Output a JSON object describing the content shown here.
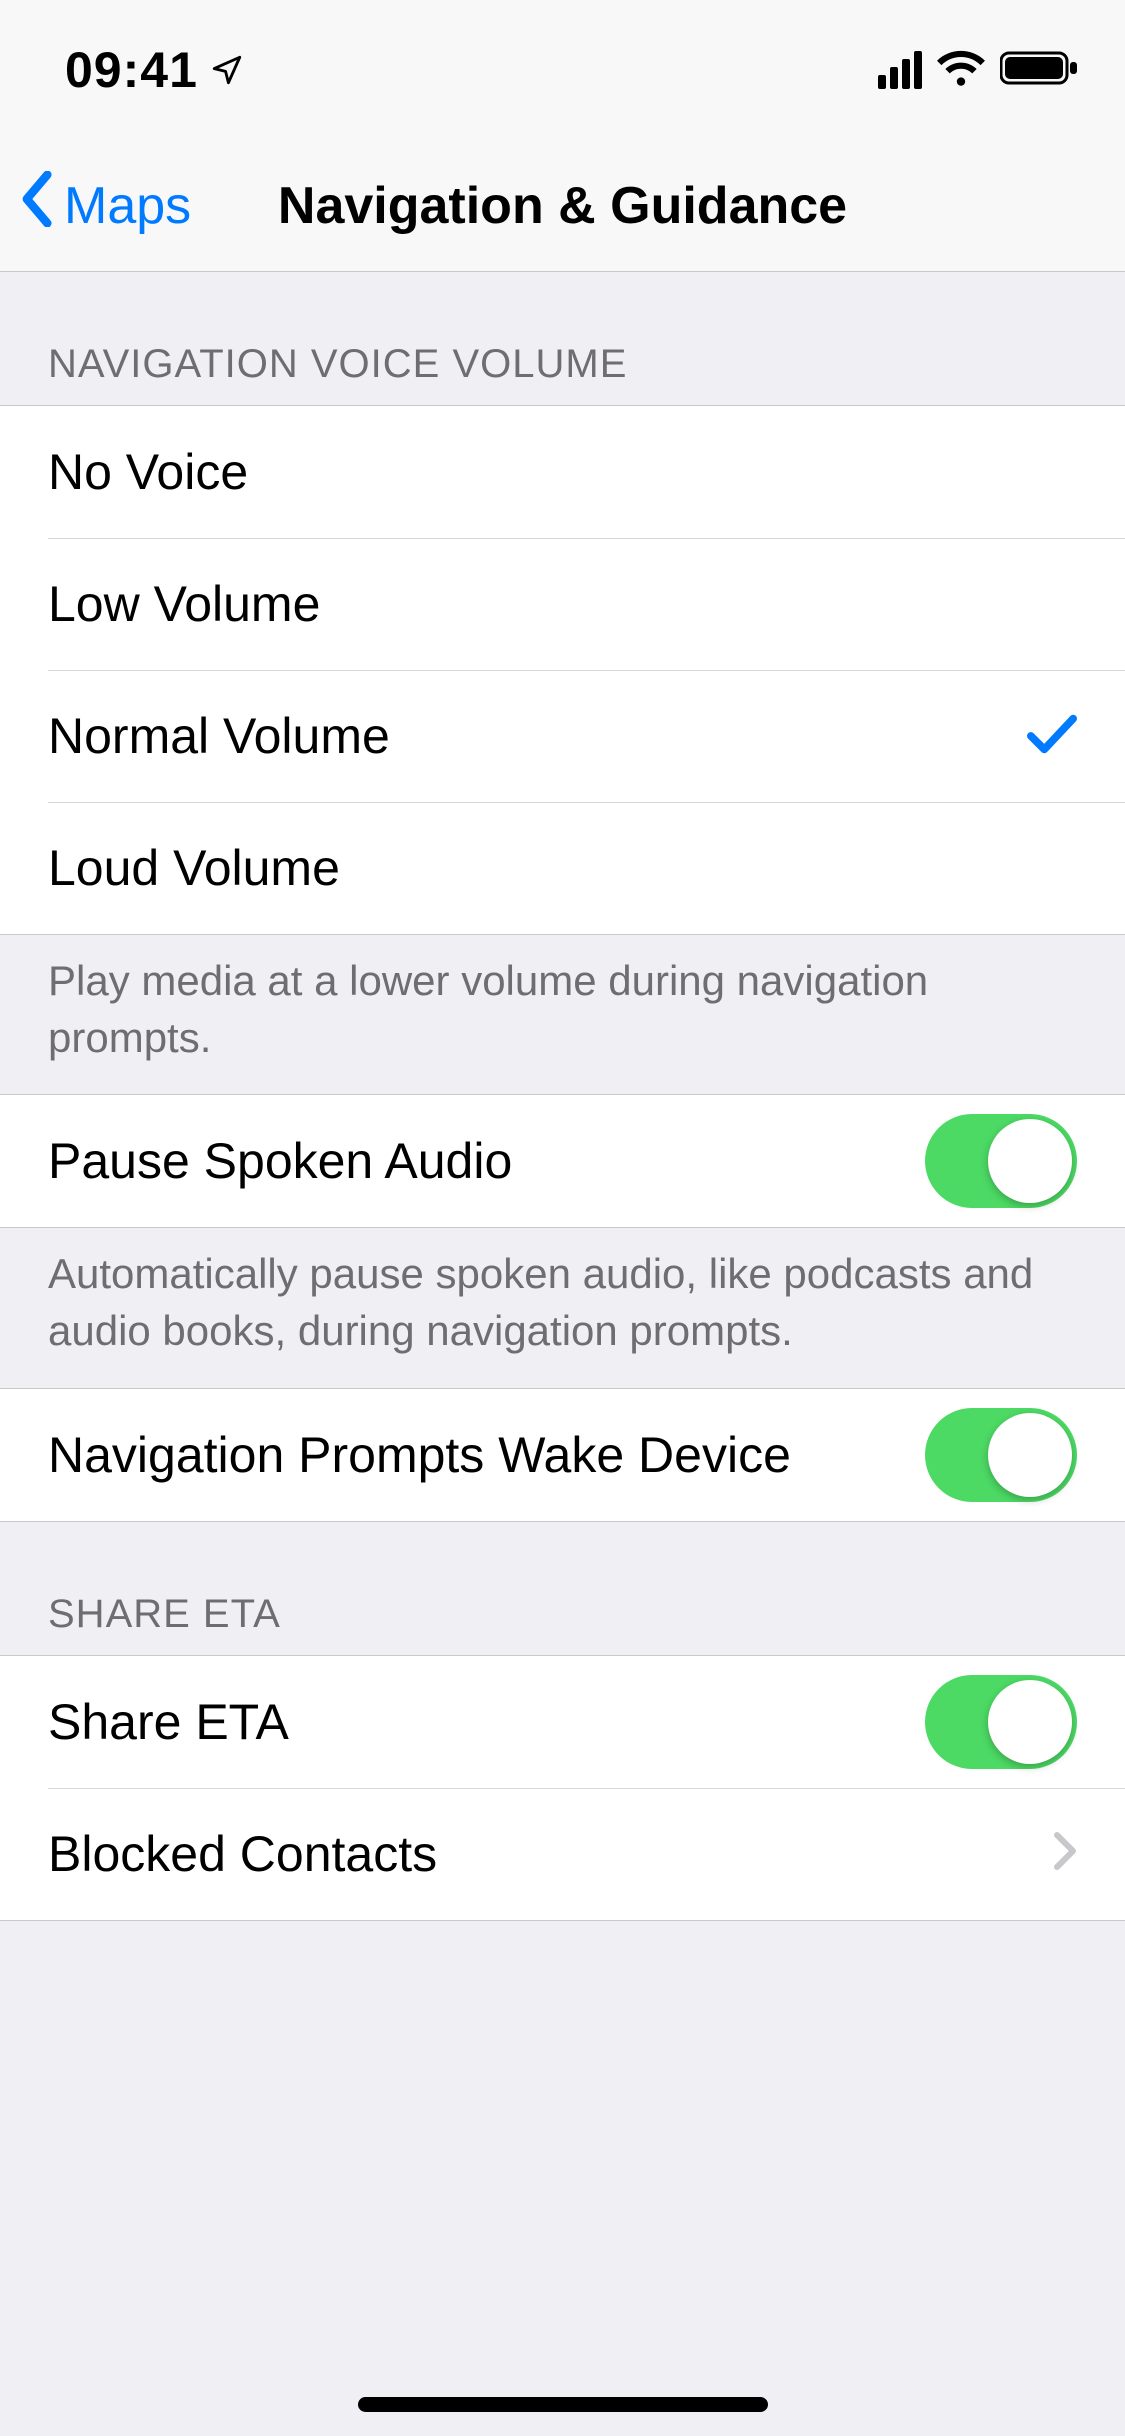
{
  "statusbar": {
    "time": "09:41"
  },
  "nav": {
    "back_label": "Maps",
    "title": "Navigation & Guidance"
  },
  "sections": {
    "volume": {
      "header": "Navigation Voice Volume",
      "options": [
        {
          "label": "No Voice",
          "selected": false
        },
        {
          "label": "Low Volume",
          "selected": false
        },
        {
          "label": "Normal Volume",
          "selected": true
        },
        {
          "label": "Loud Volume",
          "selected": false
        }
      ],
      "footer": "Play media at a lower volume during navigation prompts."
    },
    "pause_audio": {
      "label": "Pause Spoken Audio",
      "value": true,
      "footer": "Automatically pause spoken audio, like podcasts and audio books, during navigation prompts."
    },
    "wake_device": {
      "label": "Navigation Prompts Wake Device",
      "value": true
    },
    "share_eta": {
      "header": "Share ETA",
      "toggle_label": "Share ETA",
      "toggle_value": true,
      "blocked_label": "Blocked Contacts"
    }
  },
  "colors": {
    "accent": "#007aff",
    "toggle_on": "#4cd964"
  }
}
